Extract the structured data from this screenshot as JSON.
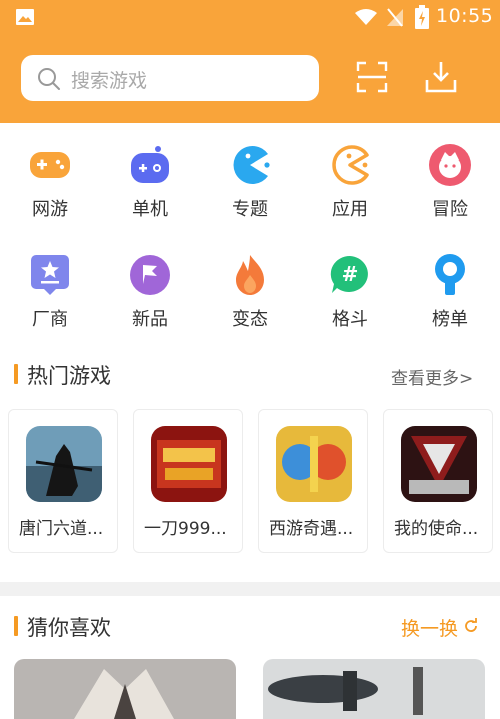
{
  "status_bar": {
    "time": "10:55"
  },
  "search": {
    "placeholder": "搜索游戏"
  },
  "categories": [
    {
      "label": "网游",
      "icon": "gamepad-icon",
      "color": "#f9a43a"
    },
    {
      "label": "单机",
      "icon": "controller-icon",
      "color": "#5b6bf0"
    },
    {
      "label": "专题",
      "icon": "pacman-icon",
      "color": "#2aa8ef"
    },
    {
      "label": "应用",
      "icon": "pacman-outline-icon",
      "color": "#f9a43a"
    },
    {
      "label": "冒险",
      "icon": "adventure-icon",
      "color": "#ee5a6f"
    },
    {
      "label": "厂商",
      "icon": "star-board-icon",
      "color": "#7f86ec"
    },
    {
      "label": "新品",
      "icon": "flag-icon",
      "color": "#a066d8"
    },
    {
      "label": "变态",
      "icon": "flame-icon",
      "color": "#f47a3a"
    },
    {
      "label": "格斗",
      "icon": "hash-chat-icon",
      "color": "#22c07a"
    },
    {
      "label": "榜单",
      "icon": "medal-icon",
      "color": "#1f9bef"
    }
  ],
  "hot_games": {
    "title": "热门游戏",
    "more": "查看更多>",
    "items": [
      {
        "name": "唐门六道..."
      },
      {
        "name": "一刀999..."
      },
      {
        "name": "西游奇遇..."
      },
      {
        "name": "我的使命..."
      }
    ]
  },
  "guess": {
    "title": "猜你喜欢",
    "swap": "换一换"
  },
  "colors": {
    "accent": "#f9a43a",
    "divider": "#f1f1f1"
  }
}
